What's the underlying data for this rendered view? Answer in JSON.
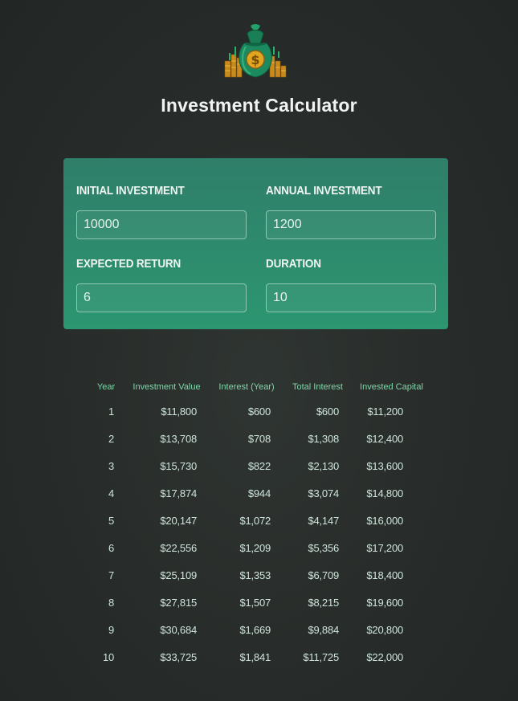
{
  "header": {
    "logo_icon": "money-bag-icon",
    "title": "Investment Calculator"
  },
  "inputs": {
    "initial_investment": {
      "label": "INITIAL INVESTMENT",
      "value": "10000"
    },
    "annual_investment": {
      "label": "ANNUAL INVESTMENT",
      "value": "1200"
    },
    "expected_return": {
      "label": "EXPECTED RETURN",
      "value": "6"
    },
    "duration": {
      "label": "DURATION",
      "value": "10"
    }
  },
  "table": {
    "headers": [
      "Year",
      "Investment Value",
      "Interest (Year)",
      "Total Interest",
      "Invested Capital"
    ],
    "rows": [
      [
        "1",
        "$11,800",
        "$600",
        "$600",
        "$11,200"
      ],
      [
        "2",
        "$13,708",
        "$708",
        "$1,308",
        "$12,400"
      ],
      [
        "3",
        "$15,730",
        "$822",
        "$2,130",
        "$13,600"
      ],
      [
        "4",
        "$17,874",
        "$944",
        "$3,074",
        "$14,800"
      ],
      [
        "5",
        "$20,147",
        "$1,072",
        "$4,147",
        "$16,000"
      ],
      [
        "6",
        "$22,556",
        "$1,209",
        "$5,356",
        "$17,200"
      ],
      [
        "7",
        "$25,109",
        "$1,353",
        "$6,709",
        "$18,400"
      ],
      [
        "8",
        "$27,815",
        "$1,507",
        "$8,215",
        "$19,600"
      ],
      [
        "9",
        "$30,684",
        "$1,669",
        "$9,884",
        "$20,800"
      ],
      [
        "10",
        "$33,725",
        "$1,841",
        "$11,725",
        "$22,000"
      ]
    ]
  },
  "colors": {
    "background": "#272b29",
    "panel_top": "#2f7e69",
    "panel_bottom": "#2c9670",
    "header_text": "#7ed7a8",
    "cell_text": "#cfe5dc",
    "title_text": "#f1f3f2"
  }
}
